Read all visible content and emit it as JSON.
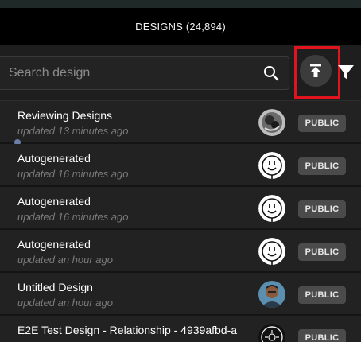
{
  "header": {
    "title": "DESIGNS (24,894)"
  },
  "search": {
    "placeholder": "Search design",
    "value": ""
  },
  "toolbar": {
    "upload_icon": "upload-icon",
    "filter_icon": "filter-icon",
    "highlight_color": "#e0141e"
  },
  "designs": [
    {
      "name": "Reviewing Designs",
      "updated": "updated 13 minutes ago",
      "visibility": "PUBLIC",
      "avatar": "photo-avatar-dark"
    },
    {
      "name": "Autogenerated",
      "updated": "updated 16 minutes ago",
      "visibility": "PUBLIC",
      "avatar": "smiley-avatar"
    },
    {
      "name": "Autogenerated",
      "updated": "updated 16 minutes ago",
      "visibility": "PUBLIC",
      "avatar": "smiley-avatar"
    },
    {
      "name": "Autogenerated",
      "updated": "updated an hour ago",
      "visibility": "PUBLIC",
      "avatar": "smiley-avatar"
    },
    {
      "name": "Untitled Design",
      "updated": "updated an hour ago",
      "visibility": "PUBLIC",
      "avatar": "photo-avatar-person"
    },
    {
      "name": "E2E Test Design - Relationship - 4939afbd-a",
      "updated": "",
      "visibility": "PUBLIC",
      "avatar": "compass-avatar"
    }
  ]
}
